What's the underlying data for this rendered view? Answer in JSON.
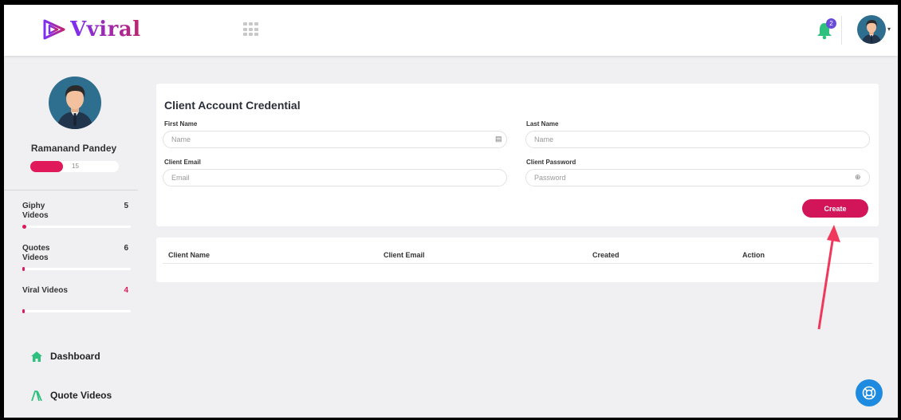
{
  "header": {
    "logo_text": "Vviral",
    "notification_count": "2"
  },
  "sidebar": {
    "user_name": "Ramanand Pandey",
    "level_value": "15",
    "level_fill_fraction": 0.37,
    "stats": [
      {
        "label": "Giphy Videos",
        "count": "5",
        "fill_fraction": 0.04
      },
      {
        "label": "Quotes Videos",
        "count": "6",
        "fill_fraction": 0.01
      },
      {
        "label": "Viral Videos",
        "count": "4",
        "fill_fraction": 0.01
      }
    ],
    "nav": [
      {
        "label": "Dashboard",
        "icon": "home-icon"
      },
      {
        "label": "Quote Videos",
        "icon": "quote-videos-icon"
      }
    ]
  },
  "form": {
    "title": "Client Account Credential",
    "first_name_label": "First Name",
    "first_name_placeholder": "Name",
    "last_name_label": "Last Name",
    "last_name_placeholder": "Name",
    "email_label": "Client Email",
    "email_placeholder": "Email",
    "password_label": "Client Password",
    "password_placeholder": "Password",
    "create_label": "Create"
  },
  "table": {
    "columns": [
      "Client Name",
      "Client Email",
      "Created",
      "Action"
    ]
  },
  "colors": {
    "accent": "#d21458",
    "brand_purple": "#7b2ff7",
    "nav_icon_green": "#2ec07f",
    "help_blue": "#1f8be0"
  }
}
